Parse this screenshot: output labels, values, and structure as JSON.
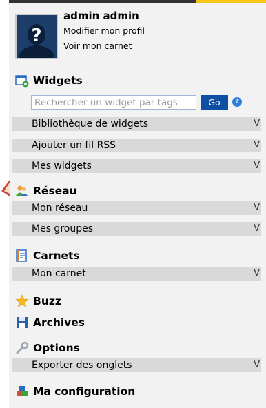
{
  "profile": {
    "username": "admin admin",
    "links": [
      "Modifier mon profil",
      "Voir mon carnet"
    ]
  },
  "widgets": {
    "title": "Widgets",
    "search_placeholder": "Rechercher un widget par tags",
    "go_label": "Go",
    "items": [
      "Bibliothèque de widgets",
      "Ajouter un fil RSS",
      "Mes widgets"
    ]
  },
  "reseau": {
    "title": "Réseau",
    "items": [
      "Mon réseau",
      "Mes groupes"
    ]
  },
  "carnets": {
    "title": "Carnets",
    "items": [
      "Mon carnet"
    ]
  },
  "buzz": {
    "title": "Buzz"
  },
  "archives": {
    "title": "Archives"
  },
  "options": {
    "title": "Options",
    "items": [
      "Exporter des onglets"
    ]
  },
  "configuration": {
    "title": "Ma configuration"
  },
  "expand_glyph": "V",
  "help_glyph": "?",
  "colors": {
    "panel_bg": "#f2f2f2",
    "row_bg": "#d9d9d9",
    "go_button": "#0e4fa3",
    "accent": "#f5c518"
  },
  "icons": {
    "avatar": "user-avatar-placeholder",
    "widgets": "widgets-icon",
    "reseau": "people-icon",
    "carnets": "notebook-icon",
    "buzz": "star-icon",
    "archives": "floppy-disk-icon",
    "options": "wrench-icon",
    "configuration": "cubes-icon"
  }
}
